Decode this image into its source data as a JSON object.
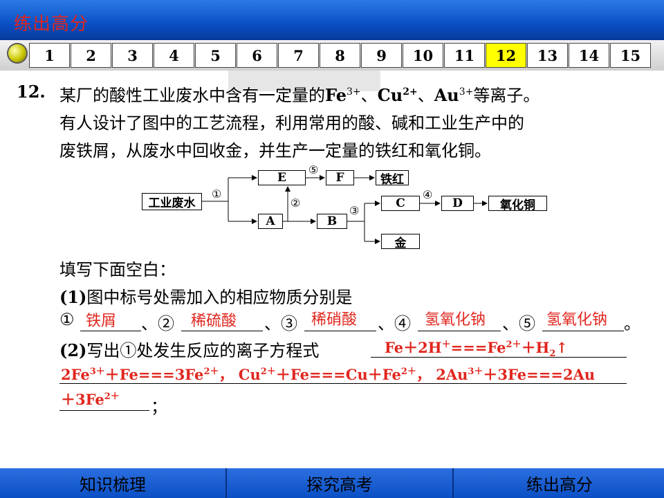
{
  "header": {
    "title": "练出高分"
  },
  "nav": {
    "tabs": [
      "1",
      "2",
      "3",
      "4",
      "5",
      "6",
      "7",
      "8",
      "9",
      "10",
      "11",
      "12",
      "13",
      "14",
      "15"
    ],
    "active": "12"
  },
  "question": {
    "number": "12",
    "dot": ".",
    "line1_a": "某厂的酸性工业废水中含有一定量的",
    "fe": "Fe",
    "fe_sup": "3+",
    "sep1": "、",
    "cu": "Cu",
    "cu_sup": "2+",
    "sep2": "、",
    "au": "Au",
    "au_sup": "3+",
    "line1_b": "等离子。",
    "line2": "有人设计了图中的工艺流程，利用常用的酸、碱和工业生产中的",
    "line3": "废铁屑，从废水中回收金，并生产一定量的铁红和氧化铜。"
  },
  "diagram": {
    "start": "工业废水",
    "E": "E",
    "F": "F",
    "tiehong": "铁红",
    "A": "A",
    "B": "B",
    "C": "C",
    "D": "D",
    "cuo": "氧化铜",
    "gold": "金",
    "n1": "①",
    "n2": "②",
    "n3": "③",
    "n4": "④",
    "n5": "⑤"
  },
  "fill": {
    "intro": "填写下面空白：",
    "part1_label": "(1)",
    "part1_text": "图中标号处需加入的相应物质分别是",
    "c1": "①",
    "c2": "、②",
    "c3": "、③",
    "c4": "、④",
    "c5": "、⑤",
    "end": "。",
    "ans1": "铁屑",
    "ans2": "稀硫酸",
    "ans3": "稀硝酸",
    "ans4": "氢氧化钠",
    "ans5": "氢氧化钠",
    "part2_label": "(2)",
    "part2_text": "写出①处发生反应的离子方程式",
    "eq1": "Fe＋2H",
    "eq1_sup": "＋",
    "eq1_b": "===Fe",
    "eq1_sup2": "2＋",
    "eq1_c": "＋H",
    "eq1_sub": "2",
    "eq1_d": "↑",
    "eq2": "2Fe",
    "eq2_sup": "3＋",
    "eq2_b": "＋Fe===3Fe",
    "eq2_sup2": "2＋",
    "eq2_c": "，  Cu",
    "eq2_sup3": "2＋",
    "eq2_d": "＋Fe===Cu＋Fe",
    "eq2_sup4": "2＋",
    "eq2_e": "，  2Au",
    "eq2_sup5": "3＋",
    "eq2_f": "＋3Fe===2Au",
    "eq3": "＋3Fe",
    "eq3_sup": "2＋",
    "semicolon": "；"
  },
  "footer": {
    "btn1": "知识梳理",
    "btn2": "探究高考",
    "btn3": "练出高分"
  }
}
